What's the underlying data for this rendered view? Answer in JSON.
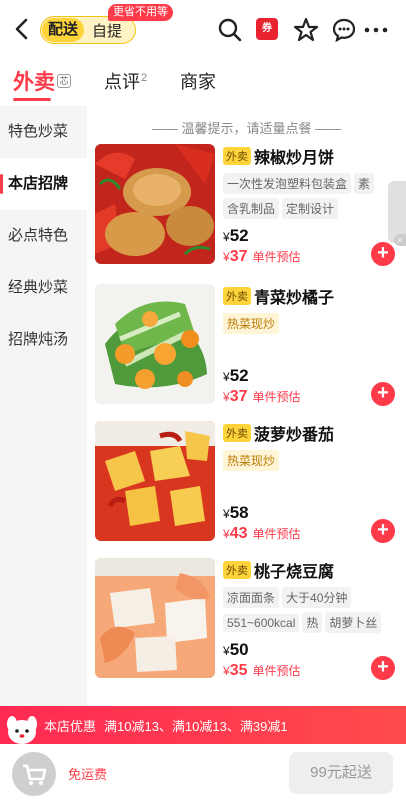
{
  "header": {
    "mode_active": "配送",
    "mode_other": "自提",
    "promo_pill": "更省不用等",
    "coupon_badge": "券"
  },
  "tabs": [
    {
      "label": "外卖"
    },
    {
      "label": "点评",
      "count": "2"
    },
    {
      "label": "商家"
    }
  ],
  "sort_icon": "芯",
  "sidebar": {
    "items": [
      {
        "label": "特色炒菜"
      },
      {
        "label": "本店招牌"
      },
      {
        "label": "必点特色"
      },
      {
        "label": "经典炒菜"
      },
      {
        "label": "招牌炖汤"
      }
    ]
  },
  "hint": "—— 温馨提示，请适量点餐 ——",
  "dishes": [
    {
      "tag": "外卖",
      "name": "辣椒炒月饼",
      "attrs": [
        "一次性发泡塑料包装盒",
        "素",
        "含乳制品",
        "定制设计"
      ],
      "price": "52",
      "discount_price": "37",
      "discount_label": "单件预估"
    },
    {
      "tag": "外卖",
      "name": "青菜炒橘子",
      "attrs": [
        "热菜现炒"
      ],
      "price": "52",
      "discount_price": "37",
      "discount_label": "单件预估"
    },
    {
      "tag": "外卖",
      "name": "菠萝炒番茄",
      "attrs": [
        "热菜现炒"
      ],
      "price": "58",
      "discount_price": "43",
      "discount_label": "单件预估"
    },
    {
      "tag": "外卖",
      "name": "桃子烧豆腐",
      "attrs": [
        "凉面面条",
        "大于40分钟",
        "551~600kcal",
        "热",
        "胡萝卜丝"
      ],
      "price": "50",
      "discount_price": "35",
      "discount_label": "单件预估"
    }
  ],
  "currency": "¥",
  "promo": {
    "label": "本店优惠",
    "offers": "满10减13、满10减13、满39减1"
  },
  "bottom": {
    "free_shipping": "免运费",
    "min_order": "99元起送"
  },
  "icons": [
    "back-icon",
    "search-icon",
    "coupon-icon",
    "star-icon",
    "chat-icon",
    "more-icon",
    "cart-icon",
    "add-icon"
  ],
  "colors": {
    "accent": "#ff3b4a",
    "mode_bg": "#ffd43b"
  }
}
